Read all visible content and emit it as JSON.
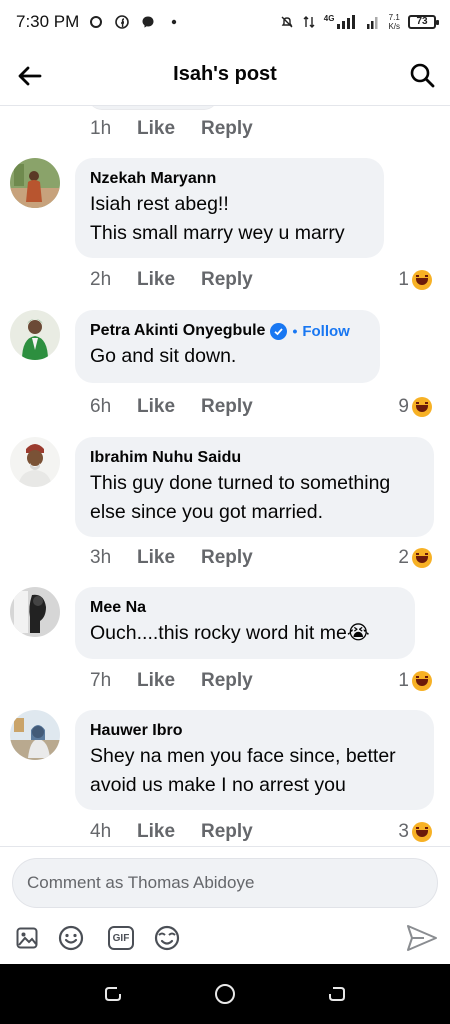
{
  "status_bar": {
    "time": "7:30 PM",
    "network": "4G",
    "speed_value": "7.1",
    "speed_unit": "K/s",
    "battery": "73"
  },
  "header": {
    "title": "Isah's post",
    "back_icon": "back-arrow-icon",
    "search_icon": "search-icon"
  },
  "previous_comment": {
    "time": "1h",
    "like": "Like",
    "reply": "Reply"
  },
  "comments": [
    {
      "name": "Nzekah Maryann",
      "lines": [
        "Isiah rest abeg!!",
        "This small marry wey u marry"
      ],
      "time": "2h",
      "like": "Like",
      "reply": "Reply",
      "reaction_count": "1"
    },
    {
      "name": "Petra Akinti Onyegbule",
      "verified": true,
      "follow": "Follow",
      "lines": [
        "Go and sit down."
      ],
      "time": "6h",
      "like": "Like",
      "reply": "Reply",
      "reaction_count": "9"
    },
    {
      "name": "Ibrahim Nuhu Saidu",
      "lines": [
        "This guy done turned to something",
        "else since you got married."
      ],
      "time": "3h",
      "like": "Like",
      "reply": "Reply",
      "reaction_count": "2"
    },
    {
      "name": "Mee Na",
      "lines": [
        "Ouch....this rocky word hit me😭"
      ],
      "time": "7h",
      "like": "Like",
      "reply": "Reply",
      "reaction_count": "1"
    },
    {
      "name": "Hauwer Ibro",
      "lines": [
        "Shey na men you face since, better",
        "avoid us make I no arrest you"
      ],
      "time": "4h",
      "like": "Like",
      "reply": "Reply",
      "reaction_count": "3"
    }
  ],
  "composer": {
    "placeholder": "Comment as Thomas Abidoye",
    "tools": [
      "image-icon",
      "emoji-icon",
      "gif-icon",
      "sticker-icon"
    ],
    "gif_label": "GIF",
    "send_icon": "send-icon"
  },
  "colors": {
    "bubble_bg": "#f0f2f5",
    "meta_text": "#65676b",
    "accent_blue": "#1877f2",
    "haha_yellow": "#f7b125"
  }
}
